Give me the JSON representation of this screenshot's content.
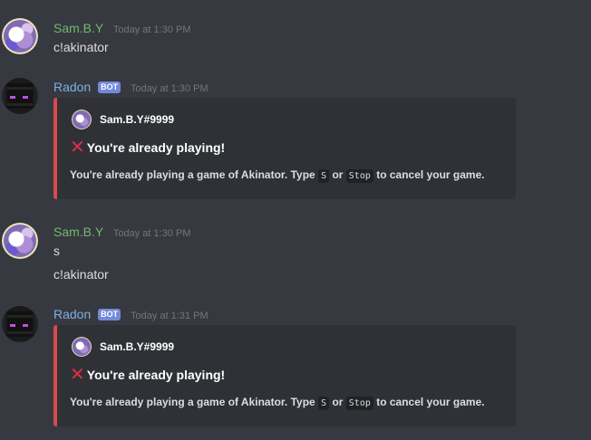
{
  "messages": [
    {
      "author": "Sam.B.Y",
      "timestamp": "Today at 1:30 PM",
      "lines": [
        "c!akinator"
      ]
    },
    {
      "author": "Radon",
      "badge": "BOT",
      "timestamp": "Today at 1:30 PM",
      "embed": {
        "author_name": "Sam.B.Y#9999",
        "title_icon": "cross-mark-icon",
        "title": "You're already playing!",
        "desc_before": "You're already playing a game of Akinator. Type",
        "code1": "S",
        "desc_mid": "or",
        "code2": "Stop",
        "desc_after": "to cancel your game.",
        "accent_color": "#d64b4b"
      }
    },
    {
      "author": "Sam.B.Y",
      "timestamp": "Today at 1:30 PM",
      "lines": [
        "s",
        "c!akinator"
      ]
    },
    {
      "author": "Radon",
      "badge": "BOT",
      "timestamp": "Today at 1:31 PM",
      "embed": {
        "author_name": "Sam.B.Y#9999",
        "title_icon": "cross-mark-icon",
        "title": "You're already playing!",
        "desc_before": "You're already playing a game of Akinator. Type",
        "code1": "S",
        "desc_mid": "or",
        "code2": "Stop",
        "desc_after": "to cancel your game.",
        "accent_color": "#d64b4b"
      }
    }
  ],
  "colors": {
    "background": "#36393f",
    "embed_bg": "#2f3136",
    "user_name": "#72b86c",
    "bot_name": "#7db0e3",
    "badge": "#7289da"
  }
}
